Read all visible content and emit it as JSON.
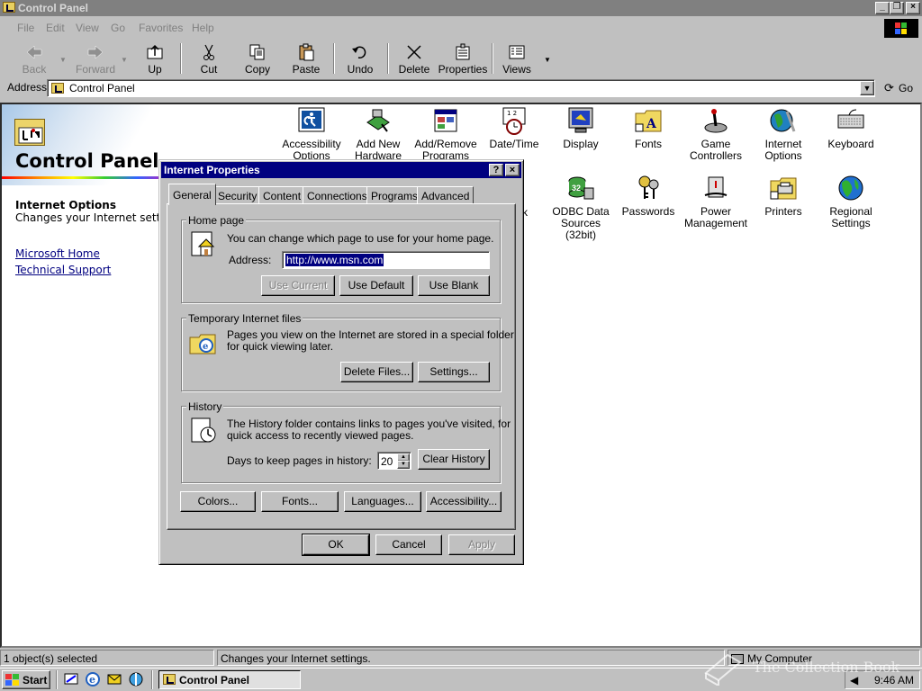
{
  "window": {
    "title": "Control Panel",
    "controls": [
      "_",
      "❐",
      "×"
    ]
  },
  "menubar": [
    {
      "label": "File"
    },
    {
      "label": "Edit"
    },
    {
      "label": "View"
    },
    {
      "label": "Go"
    },
    {
      "label": "Favorites"
    },
    {
      "label": "Help"
    }
  ],
  "toolbar": {
    "back": "Back",
    "forward": "Forward",
    "up": "Up",
    "cut": "Cut",
    "copy": "Copy",
    "paste": "Paste",
    "undo": "Undo",
    "delete": "Delete",
    "properties": "Properties",
    "views": "Views"
  },
  "address": {
    "label": "Address",
    "value": "Control Panel",
    "go": "Go"
  },
  "webview": {
    "title": "Control Panel",
    "selected_name": "Internet Options",
    "selected_desc": "Changes your Internet setti",
    "links": [
      "Microsoft Home",
      "Technical Support"
    ]
  },
  "icons": {
    "row1": [
      {
        "label": "Accessibility Options",
        "icon": "accessibility-icon"
      },
      {
        "label": "Add New Hardware",
        "icon": "add-hardware-icon"
      },
      {
        "label": "Add/Remove Programs",
        "icon": "add-remove-programs-icon"
      },
      {
        "label": "Date/Time",
        "icon": "date-time-icon"
      },
      {
        "label": "Display",
        "icon": "display-icon"
      },
      {
        "label": "Fonts",
        "icon": "fonts-icon"
      },
      {
        "label": "Game Controllers",
        "icon": "game-controllers-icon"
      },
      {
        "label": "Internet Options",
        "icon": "internet-options-icon"
      },
      {
        "label": "Keyboard",
        "icon": "keyboard-icon"
      }
    ],
    "row2": [
      {
        "label": "ODBC Data Sources (32bit)",
        "icon": "odbc-icon"
      },
      {
        "label": "Passwords",
        "icon": "passwords-icon"
      },
      {
        "label": "Power Management",
        "icon": "power-management-icon"
      },
      {
        "label": "Printers",
        "icon": "printers-icon"
      },
      {
        "label": "Regional Settings",
        "icon": "regional-settings-icon"
      }
    ],
    "partial_label": "rk"
  },
  "dialog": {
    "title": "Internet Properties",
    "help_btn": "?",
    "close_btn": "×",
    "tabs": [
      "General",
      "Security",
      "Content",
      "Connections",
      "Programs",
      "Advanced"
    ],
    "homepage": {
      "group": "Home page",
      "desc": "You can change which page to use for your home page.",
      "address_label": "Address:",
      "address_value": "http://www.msn.com",
      "use_current": "Use Current",
      "use_default": "Use Default",
      "use_blank": "Use Blank"
    },
    "temp": {
      "group": "Temporary Internet files",
      "desc1": "Pages you view on the Internet are stored in a special folder",
      "desc2": "for quick viewing later.",
      "delete_files": "Delete Files...",
      "settings": "Settings..."
    },
    "history": {
      "group": "History",
      "desc1": "The History folder contains links to pages you've visited, for",
      "desc2": "quick access to recently viewed pages.",
      "days_label": "Days to keep pages in history:",
      "days_value": "20",
      "clear": "Clear History"
    },
    "bottom_buttons": {
      "colors": "Colors...",
      "fonts": "Fonts...",
      "languages": "Languages...",
      "accessibility": "Accessibility..."
    },
    "ok": "OK",
    "cancel": "Cancel",
    "apply": "Apply"
  },
  "statusbar": {
    "count": "1 object(s) selected",
    "desc": "Changes your Internet settings.",
    "zone": "My Computer"
  },
  "taskbar": {
    "start": "Start",
    "task": "Control Panel",
    "clock": "9:46 AM"
  },
  "watermark": "The Collection Book",
  "colors": {
    "face": "#c0c0c0",
    "active_title": "#000080",
    "inactive_title": "#808080",
    "link": "#000080"
  }
}
